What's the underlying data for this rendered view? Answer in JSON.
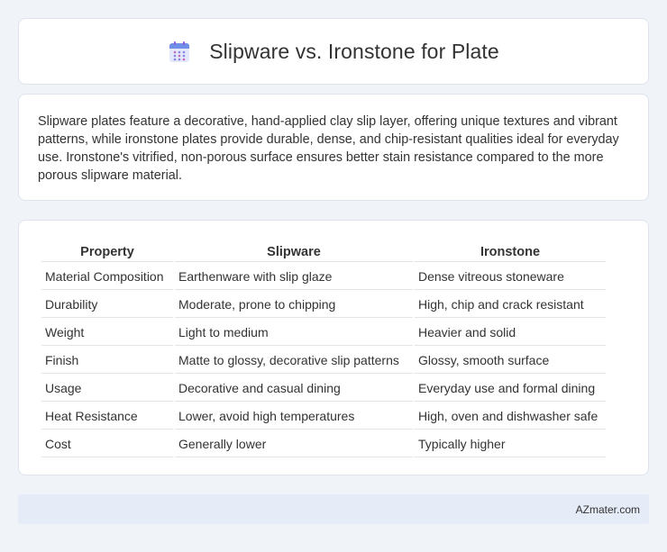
{
  "header": {
    "title": "Slipware vs. Ironstone for Plate",
    "icon": "calendar-icon"
  },
  "intro": {
    "text": "Slipware plates feature a decorative, hand-applied clay slip layer, offering unique textures and vibrant patterns, while ironstone plates provide durable, dense, and chip-resistant qualities ideal for everyday use. Ironstone's vitrified, non-porous surface ensures better stain resistance compared to the more porous slipware material."
  },
  "table": {
    "headers": [
      "Property",
      "Slipware",
      "Ironstone"
    ],
    "rows": [
      [
        "Material Composition",
        "Earthenware with slip glaze",
        "Dense vitreous stoneware"
      ],
      [
        "Durability",
        "Moderate, prone to chipping",
        "High, chip and crack resistant"
      ],
      [
        "Weight",
        "Light to medium",
        "Heavier and solid"
      ],
      [
        "Finish",
        "Matte to glossy, decorative slip patterns",
        "Glossy, smooth surface"
      ],
      [
        "Usage",
        "Decorative and casual dining",
        "Everyday use and formal dining"
      ],
      [
        "Heat Resistance",
        "Lower, avoid high temperatures",
        "High, oven and dishwasher safe"
      ],
      [
        "Cost",
        "Generally lower",
        "Typically higher"
      ]
    ]
  },
  "footer": {
    "text": "AZmater.com"
  },
  "colors": {
    "background": "#f0f3f8",
    "card": "#ffffff",
    "footer": "#e6ecf7",
    "icon_top": "#6f8fe8",
    "icon_body": "#dfe6fb"
  }
}
